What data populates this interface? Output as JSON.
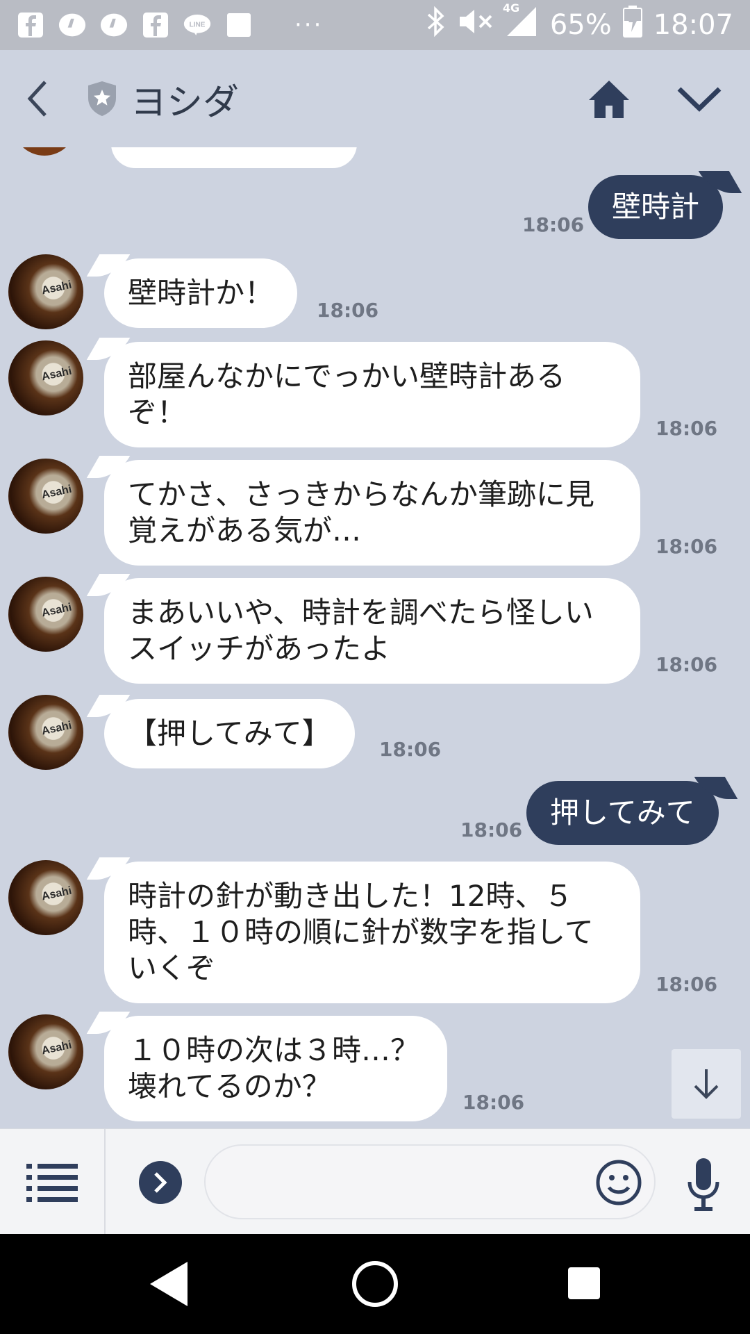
{
  "status_bar": {
    "battery": "65%",
    "time": "18:07",
    "network": "4G",
    "dots": "···"
  },
  "header": {
    "title": "ヨシダ"
  },
  "messages": [
    {
      "side": "out",
      "text": "壁時計",
      "time": "18:06"
    },
    {
      "side": "in",
      "text": "壁時計か！",
      "time": "18:06"
    },
    {
      "side": "in",
      "text": "部屋んなかにでっかい壁時計あるぞ！",
      "time": "18:06"
    },
    {
      "side": "in",
      "text": "てかさ、さっきからなんか筆跡に見覚えがある気が…",
      "time": "18:06"
    },
    {
      "side": "in",
      "text": "まあいいや、時計を調べたら怪しいスイッチがあったよ",
      "time": "18:06"
    },
    {
      "side": "in",
      "text": "【押してみて】",
      "time": "18:06"
    },
    {
      "side": "out",
      "text": "押してみて",
      "time": "18:06"
    },
    {
      "side": "in",
      "text": "時計の針が動き出した！12時、５時、１０時の順に針が数字を指していくぞ",
      "time": "18:06"
    },
    {
      "side": "in",
      "text": "１０時の次は３時…？壊れてるのか？",
      "time": "18:06"
    }
  ],
  "colors": {
    "background": "#cdd3e0",
    "outgoing_bubble": "#2f3e5c",
    "incoming_bubble": "#ffffff"
  },
  "icons": {
    "status": [
      "facebook-icon",
      "line-icon",
      "bluetooth-icon",
      "mute-icon",
      "signal-icon",
      "battery-icon"
    ],
    "header": [
      "back-arrow-icon",
      "shield-star-icon",
      "home-icon",
      "chevron-down-icon"
    ],
    "input": [
      "menu-icon",
      "chevron-right-icon",
      "emoji-icon",
      "microphone-icon"
    ]
  }
}
